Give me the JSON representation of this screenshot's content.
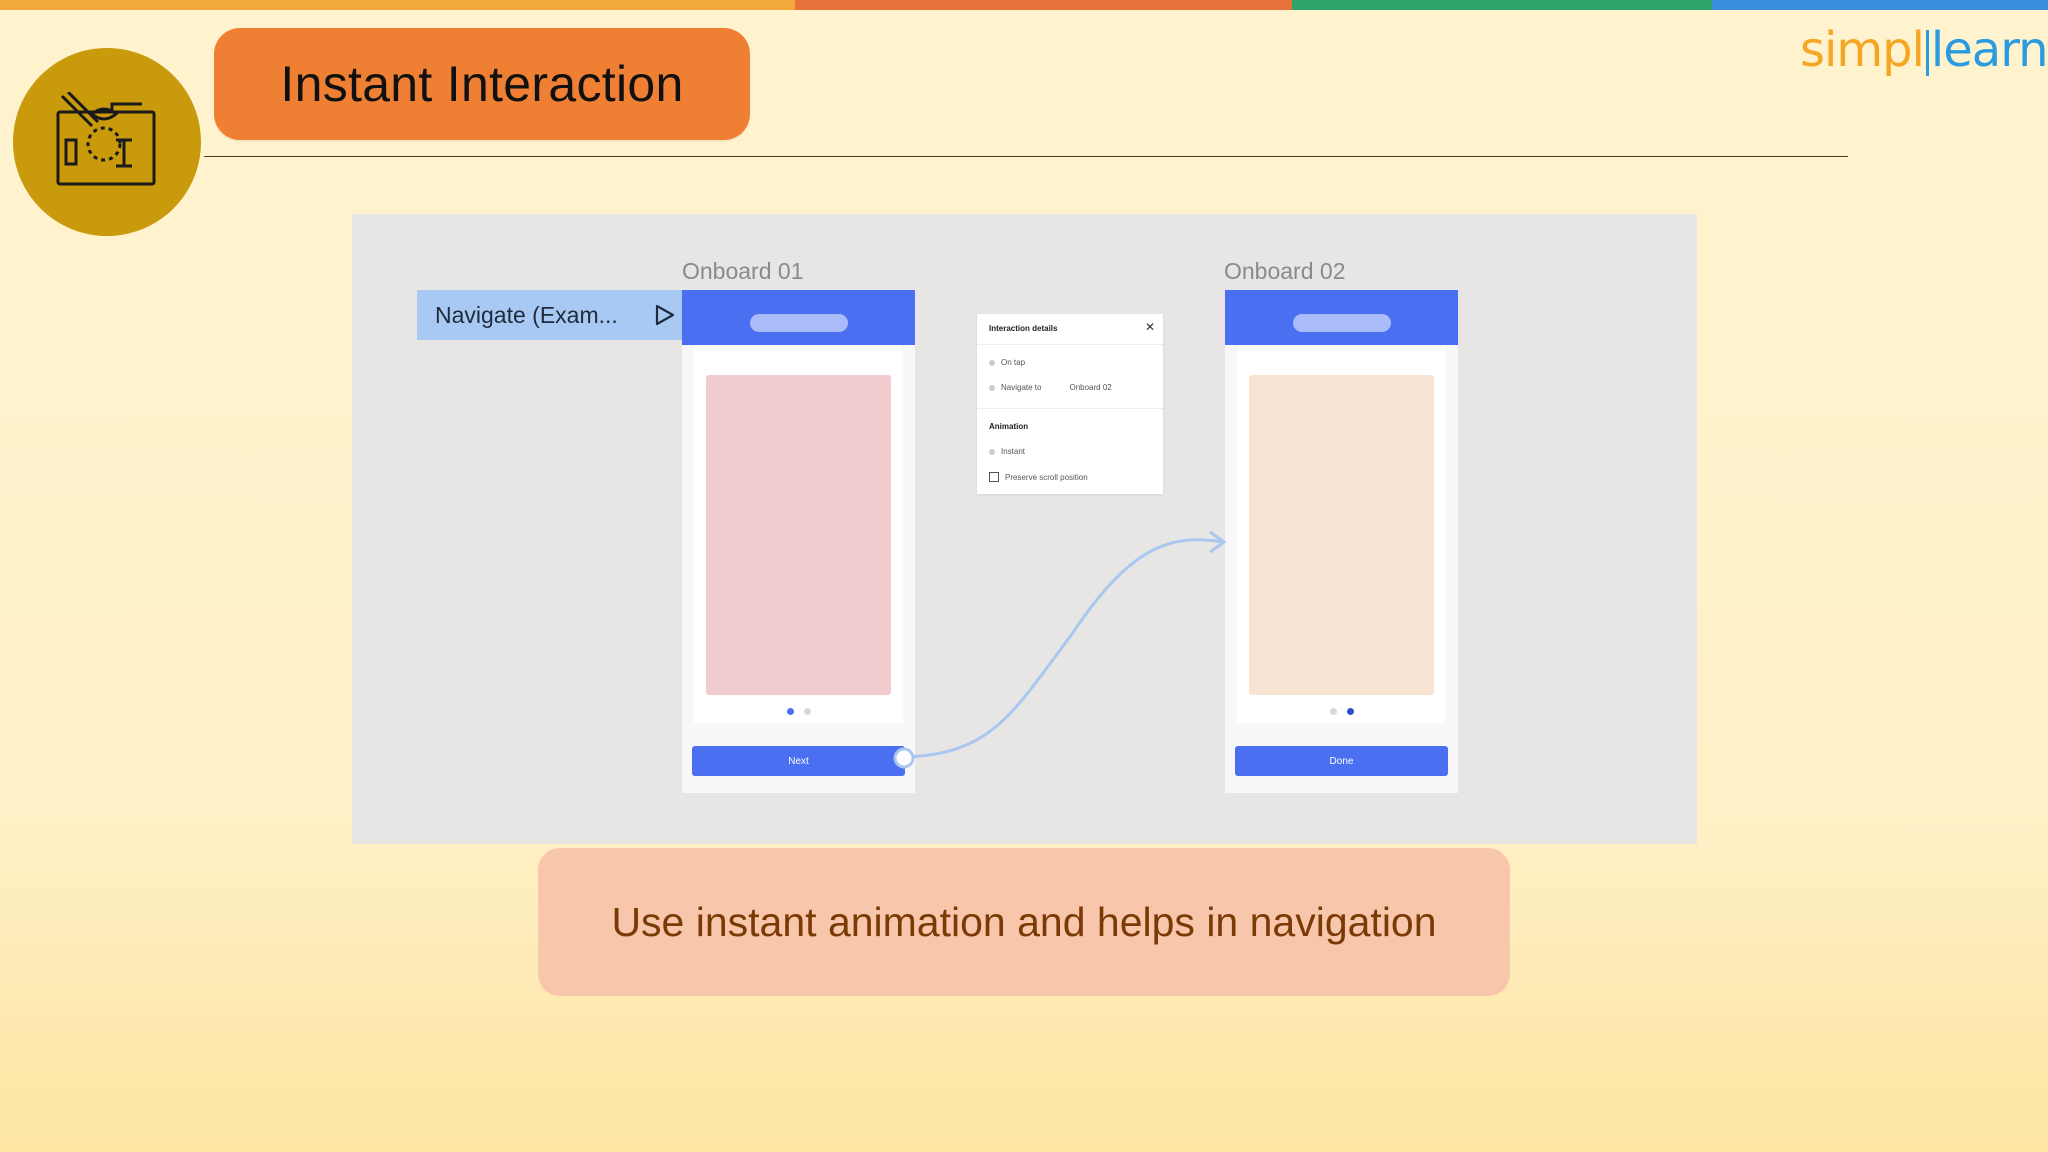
{
  "header": {
    "title": "Instant Interaction",
    "brand_part1": "simpl",
    "brand_part2": "learn"
  },
  "colors": {
    "topbar": [
      "#f3a93a",
      "#e8733a",
      "#2ea36b",
      "#3a8ee0"
    ],
    "accent_orange": "#ef7f33",
    "logo_circle": "#c89a0c",
    "prototype_blue": "#4a6ff0"
  },
  "prototype": {
    "frame1_label": "Onboard 01",
    "frame2_label": "Onboard 02",
    "flow_tag": "Navigate (Exam...",
    "frame1_button": "Next",
    "frame2_button": "Done",
    "panel": {
      "title": "Interaction details",
      "trigger": "On tap",
      "action": "Navigate to",
      "destination": "Onboard 02",
      "animation_header": "Animation",
      "animation_value": "Instant",
      "checkbox_label": "Preserve scroll position"
    }
  },
  "caption": {
    "text": "Use instant animation and helps in navigation"
  },
  "icons": [
    "design-tool-icon",
    "play-icon",
    "close-icon"
  ]
}
